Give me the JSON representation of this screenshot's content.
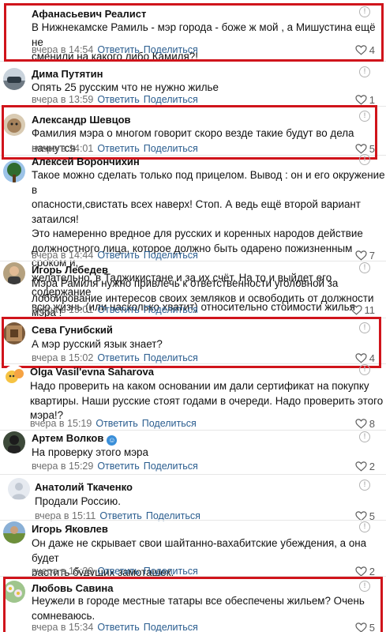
{
  "comments": [
    {
      "author": "Афанасьевич Реалист",
      "text": "В Нижнекамске Рамиль - мэр города - боже ж мой , а Мишустина ещё не\nсменили на какого либо Камиля?!",
      "time": "вчера в 14:54",
      "reply": "Ответить",
      "share": "Поделиться",
      "likes": "4",
      "avatar": "none"
    },
    {
      "author": "Дима Путятин",
      "text": "Опять 25 русским что не нужно жилье",
      "time": "вчера в 13:59",
      "reply": "Ответить",
      "share": "Поделиться",
      "likes": "1",
      "avatar": "photo-car"
    },
    {
      "author": "Александр Шевцов",
      "text": "Фамилия мэра о многом говорит скоро везде такие будут во дела начнутся",
      "time": "вчера в 14:01",
      "reply": "Ответить",
      "share": "Поделиться",
      "likes": "5",
      "avatar": "photo-dog"
    },
    {
      "author": "Алексей Ворончихин",
      "text": "Такое можно сделать только под прицелом. Вывод : он и его окружение в\nопасности,свистать всех наверх! Стоп. А ведь ещё второй вариант затаился!\nЭто намеренно вредное для русских и коренных народов действие\nдолжностного лица, которое должно быть одарено пожизненным сроком и,\nжелательно, в Таджикистане и за их счёт. На то и выйдет его содержание\nвсю жизнь (или насколько хватит) относительно стоимости жилья",
      "time": "вчера в 14:44",
      "reply": "Ответить",
      "share": "Поделиться",
      "likes": "7",
      "avatar": "photo-tree"
    },
    {
      "author": "Игорь Лебедев",
      "text": "Мэра Рамиля нужно привлечь к ответственности уголовной за\nлоббирование интересов своих земляков и освободить от должности мэра !",
      "time": "вчера в 15:01",
      "reply": "Ответить",
      "share": "Поделиться",
      "likes": "11",
      "avatar": "photo-man"
    },
    {
      "author": "Сева Гунибский",
      "text": "А мэр русский язык знает?",
      "time": "вчера в 15:02",
      "reply": "Ответить",
      "share": "Поделиться",
      "likes": "4",
      "avatar": "photo-brown"
    },
    {
      "author": "Olga Vasil'evna Saharova",
      "text": "Надо проверить на каком основании им дали сертификат на покупку\nквартиры. Наши русские стоят годами в очереди. Надо проверить этого\nмэра!?",
      "time": "вчера в 15:19",
      "reply": "Ответить",
      "share": "Поделиться",
      "likes": "8",
      "avatar": "emoji"
    },
    {
      "author": "Артем Волков",
      "text": "На проверку этого мэра",
      "time": "вчера в 15:29",
      "reply": "Ответить",
      "share": "Поделиться",
      "likes": "2",
      "avatar": "photo-dark",
      "badge": "☺"
    },
    {
      "author": "Анатолий Ткаченко",
      "text": "Продали Россию.",
      "time": "вчера в 15:11",
      "reply": "Ответить",
      "share": "Поделиться",
      "likes": "5",
      "avatar": "none"
    },
    {
      "author": "Игорь Яковлев",
      "text": "Он даже не скрывает свои шайтанно-вахабитские убеждения, а она будет\nрастить будущих замоташек.",
      "time": "вчера в 15:39",
      "reply": "Ответить",
      "share": "Поделиться",
      "likes": "2",
      "avatar": "photo-field"
    },
    {
      "author": "Любовь Савина",
      "text": "Неужели в городе местные татары все обеспечены жильем? Очень\nсомневаюсь.",
      "time": "вчера в 15:34",
      "reply": "Ответить",
      "share": "Поделиться",
      "likes": "5",
      "avatar": "photo-flowers"
    }
  ]
}
